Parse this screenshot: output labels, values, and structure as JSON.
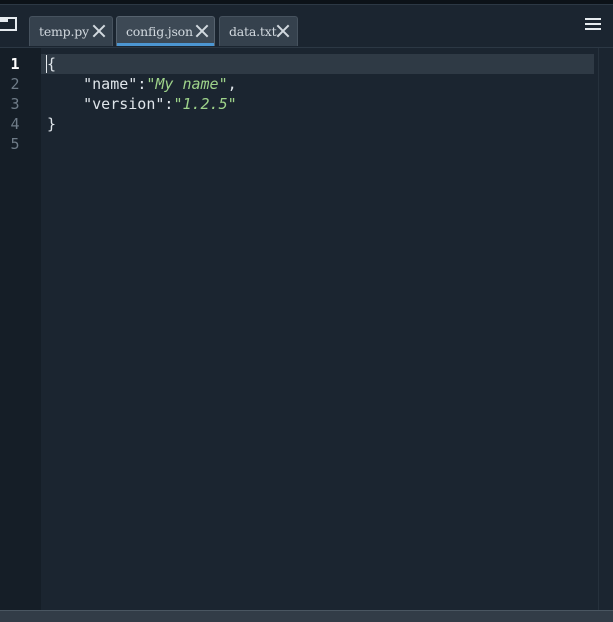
{
  "tabs": [
    {
      "label": "temp.py",
      "active": false
    },
    {
      "label": "config.json",
      "active": true
    },
    {
      "label": "data.txt",
      "active": false
    }
  ],
  "editor": {
    "line_numbers": [
      "1",
      "2",
      "3",
      "4",
      "5"
    ],
    "current_line": 1,
    "lines": [
      "{",
      "\"name\":\"My name\",",
      "\"version\":\"1.2.5\"",
      "}",
      ""
    ],
    "tokens": {
      "name_key": "\"name\"",
      "name_colon": ":",
      "name_value": "\"My name\"",
      "name_comma": ",",
      "version_key": "\"version\"",
      "version_colon": ":",
      "version_value": "\"1.2.5\"",
      "open_brace": "{",
      "close_brace": "}"
    }
  },
  "colors": {
    "background": "#1b2530",
    "gutter": "#151e27",
    "active_tab_indicator": "#4c96d2",
    "string": "#9ed38a",
    "text": "#dfe5ea"
  },
  "icons": {
    "sidebar_toggle": "sidebar-toggle-icon",
    "tab_close": "close-icon",
    "menu": "hamburger-menu-icon"
  }
}
